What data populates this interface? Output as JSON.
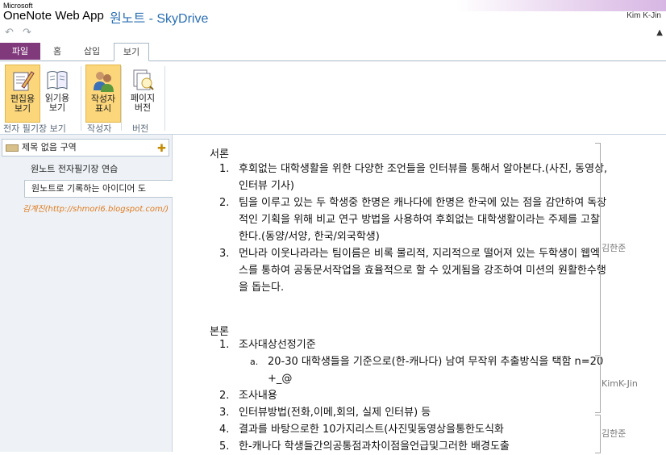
{
  "titlebar": {
    "microsoft": "Microsoft",
    "app_name": "OneNote Web App",
    "document": "원노트 - SkyDrive",
    "user": "Kim K-Jin"
  },
  "quick_access": {
    "undo_icon": "undo-icon",
    "redo_icon": "redo-icon"
  },
  "tabs": [
    "파일",
    "홈",
    "삽입",
    "보기"
  ],
  "ribbon": {
    "buttons": [
      {
        "label": "편집용\n보기",
        "icon": "edit-view-icon",
        "active": true
      },
      {
        "label": "읽기용\n보기",
        "icon": "reading-view-icon",
        "active": false
      },
      {
        "label": "작성자\n표시",
        "icon": "authors-icon",
        "active": true
      },
      {
        "label": "페이지\n버전",
        "icon": "page-versions-icon",
        "active": false
      }
    ],
    "groups": [
      "전자 필기장 보기",
      "작성자",
      "버전"
    ]
  },
  "nav": {
    "section": "제목 없음 구역",
    "pages": [
      "원노트 전자필기장 연습",
      "원노트로 기록하는 아이디어 도"
    ],
    "watermark": "김계진(http://shmori6.blogspot.com/)"
  },
  "content": {
    "intro_heading": "서론",
    "intro_items": [
      {
        "num": "1.",
        "text": "후회없는 대학생활을 위한 다양한 조언들을 인터뷰를 통해서 알아본다.(사진, 동영상, 인터뷰 기사)"
      },
      {
        "num": "2.",
        "text": "팀을 이루고 있는 두 학생중 한명은 캐나다에 한명은 한국에 있는 점을 감안하여 독창적인 기획을 위해 비교 연구 방법을 사용하여 후회없는 대학생활이라는 주제를 고찰한다.(동양/서양, 한국/외국학생)"
      },
      {
        "num": "3.",
        "text": "먼나라 이웃나라라는 팀이름은 비록 물리적, 지리적으로 떨어져 있는 두학생이 웹엑스를 통하여 공동문서작업을 효율적으로 할 수 있게됨을 강조하여 미션의 원활한수행을 돕는다."
      }
    ],
    "body_heading": "본론",
    "body_items": [
      {
        "num": "1.",
        "text": "조사대상선정기준"
      },
      {
        "num": "a.",
        "text": "20-30 대학생들을 기준으로(한-캐나다) 남여 무작위 추출방식을 택함 n=20 +_@",
        "sub": true
      },
      {
        "num": "2.",
        "text": "조사내용"
      },
      {
        "num": "3.",
        "text": "인터뷰방법(전화,이메,회의, 실제 인터뷰) 등"
      },
      {
        "num": "4.",
        "text": "결과를 바탕으로한 10가지리스트(사진및동영상을통한도식화"
      },
      {
        "num": "5.",
        "text": "한-캐나다 학생들간의공통점과차이점을언급및그러한 배경도출"
      }
    ],
    "authors": [
      "김한준",
      "KimK-Jin",
      "김한준"
    ]
  }
}
